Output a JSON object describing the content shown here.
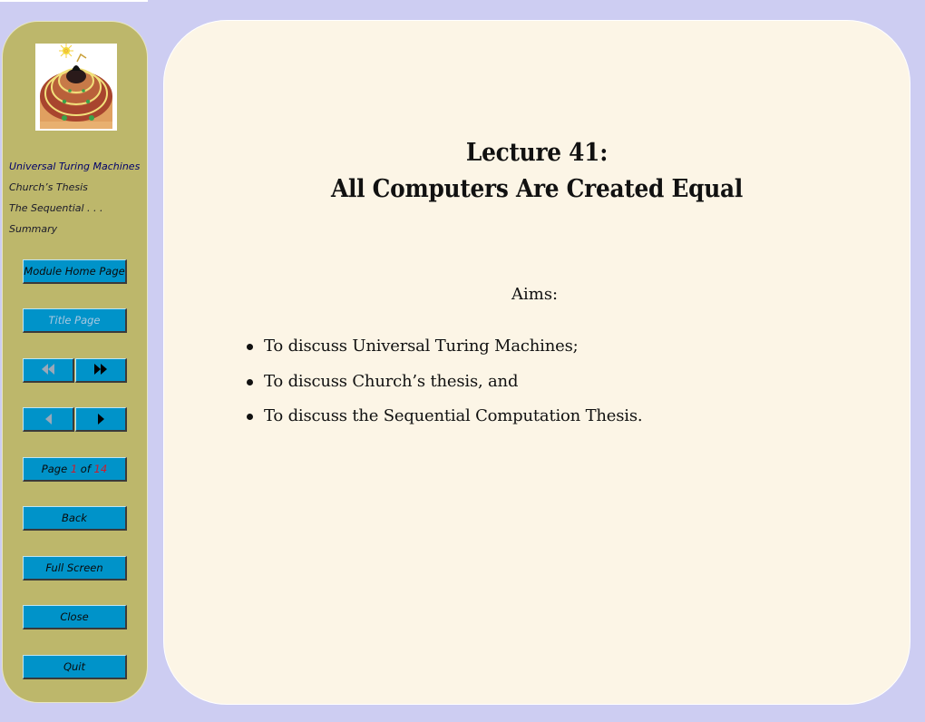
{
  "sidebar": {
    "logo": "concentric-heads-logo",
    "nav_links": [
      {
        "label": "Universal Turing Machines"
      },
      {
        "label": "Church’s Thesis"
      },
      {
        "label": "The Sequential . . ."
      },
      {
        "label": "Summary"
      }
    ],
    "buttons": {
      "module_home": "Module Home Page",
      "title_page": "Title Page",
      "first_page_icon": "double-left-triangle",
      "last_page_icon": "double-right-triangle",
      "prev_page_icon": "left-triangle",
      "next_page_icon": "right-triangle",
      "page_prefix": "Page",
      "page_current": "1",
      "page_of": "of",
      "page_total": "14",
      "back": "Back",
      "full_screen": "Full Screen",
      "close": "Close",
      "quit": "Quit"
    }
  },
  "main": {
    "title_line1": "Lecture 41:",
    "title_line2": "All Computers Are Created Equal",
    "aims_heading": "Aims:",
    "aims": [
      "To discuss Universal Turing Machines;",
      "To discuss Church’s thesis, and",
      "To discuss the Sequential Computation Thesis."
    ]
  },
  "colors": {
    "background": "#cdcdf2",
    "sidebar": "#bdb76b",
    "page": "#fcf5e6",
    "button": "#0093c9",
    "page_number_accent": "#d11a2a"
  }
}
